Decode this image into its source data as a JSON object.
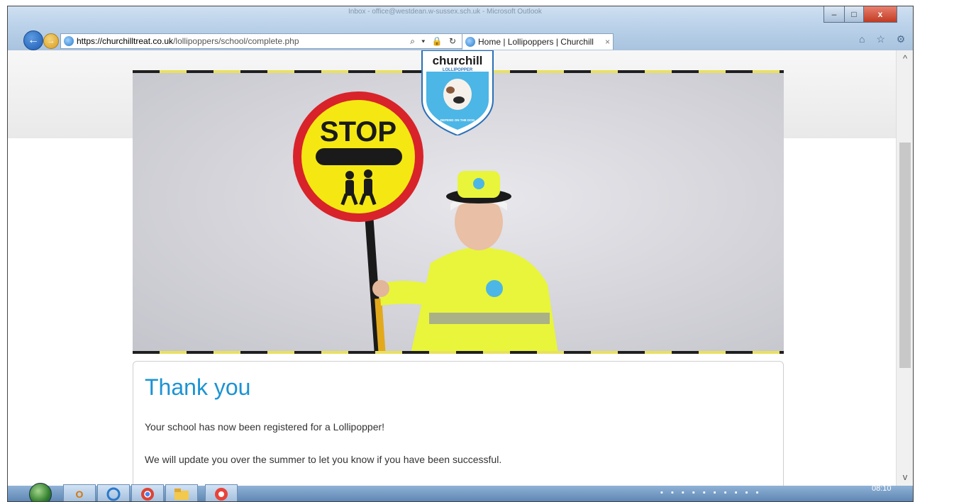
{
  "outlook_title_ghost": "Inbox - office@westdean.w-sussex.sch.uk - Microsoft Outlook",
  "window_controls": {
    "minimize": "–",
    "maximize": "□",
    "close": "x"
  },
  "nav": {
    "back": "←",
    "forward": "→"
  },
  "address": {
    "host_prefix": "https://churchilltreat.co.uk",
    "path": "/lollipoppers/school/complete.php",
    "tools": "⌕ ▾ 🔒 ↻"
  },
  "tab": {
    "label": "Home | Lollipoppers | Churchill",
    "close": "×"
  },
  "browser_icons": "⌂ ☆ ⚙",
  "logo": {
    "brand": "churchill",
    "subtitle": "LOLLIPOPPER",
    "tagline": "DEPEND ON THE DOG"
  },
  "sign": {
    "text": "STOP"
  },
  "card": {
    "title": "Thank you",
    "line1": "Your school has now been registered for a Lollipopper!",
    "line2": "We will update you over the summer to let you know if you have been successful."
  },
  "scroll": {
    "up": "^",
    "down": "v"
  },
  "taskbar": {
    "clock": "08:10",
    "outlook_badge": "O"
  },
  "colors": {
    "title_blue": "#1c93d3",
    "hivis_yellow": "#e8f53a",
    "stop_red": "#d8232a",
    "stop_yellow": "#f5e812",
    "stripe_yellow": "#e9e062"
  }
}
